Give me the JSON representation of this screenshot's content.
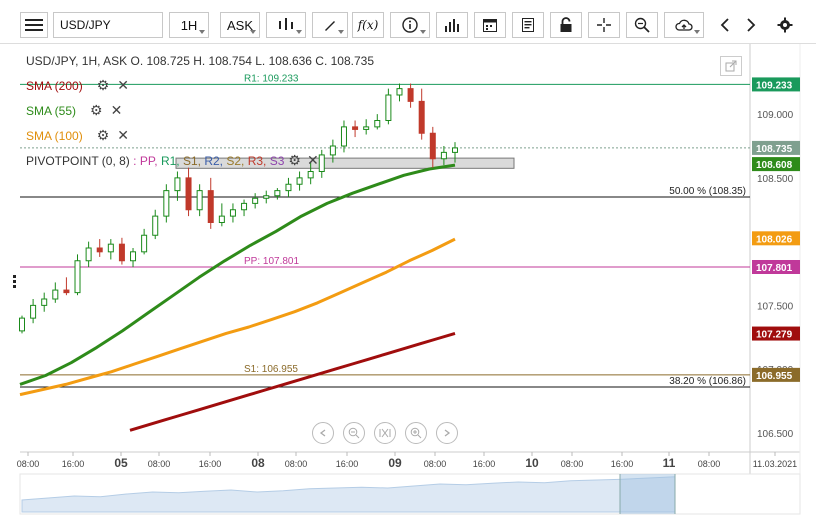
{
  "toolbar": {
    "symbol": "USD/JPY",
    "timeframe": "1H",
    "price_type": "ASK",
    "fx_label": "f(x)"
  },
  "chart_info": {
    "ohlc": "USD/JPY, 1H, ASK   O. 108.725 H. 108.754 L. 108.636 C. 108.735"
  },
  "indicators": [
    {
      "label": "SMA (200)",
      "color": "#a00d0d"
    },
    {
      "label": "SMA (55)",
      "color": "#2e8b1a"
    },
    {
      "label": "SMA (100)",
      "color": "#f39c12"
    }
  ],
  "pivot": {
    "label": "PIVOTPOINT (0, 8)",
    "sep": " : ",
    "items": [
      {
        "text": "PP,",
        "color": "#c0399a"
      },
      {
        "text": " R1,",
        "color": "#1a9a5c"
      },
      {
        "text": " S1,",
        "color": "#8b6b2a"
      },
      {
        "text": " R2,",
        "color": "#3a5da8"
      },
      {
        "text": " S2,",
        "color": "#9a7a2a"
      },
      {
        "text": " R3,",
        "color": "#c0392b"
      },
      {
        "text": " S3",
        "color": "#8e44ad"
      }
    ]
  },
  "chart_data": {
    "type": "candlestick",
    "symbol": "USD/JPY",
    "y_ticks": [
      "109.000",
      "108.500",
      "107.500",
      "107.000",
      "106.500"
    ],
    "ylim": [
      106.35,
      109.55
    ],
    "x_ticks": [
      "08:00",
      "16:00",
      "05",
      "08:00",
      "16:00",
      "08",
      "08:00",
      "16:00",
      "09",
      "08:00",
      "16:00",
      "10",
      "08:00",
      "16:00",
      "11",
      "08:00",
      "11.03.2021"
    ],
    "candles": [
      [
        107.3,
        107.42,
        107.28,
        107.4
      ],
      [
        107.4,
        107.55,
        107.36,
        107.5
      ],
      [
        107.5,
        107.6,
        107.45,
        107.55
      ],
      [
        107.55,
        107.68,
        107.52,
        107.62
      ],
      [
        107.62,
        107.72,
        107.58,
        107.6
      ],
      [
        107.6,
        107.9,
        107.58,
        107.85
      ],
      [
        107.85,
        108.0,
        107.8,
        107.95
      ],
      [
        107.95,
        108.02,
        107.88,
        107.92
      ],
      [
        107.92,
        108.02,
        107.86,
        107.98
      ],
      [
        107.98,
        108.03,
        107.82,
        107.85
      ],
      [
        107.85,
        107.95,
        107.8,
        107.92
      ],
      [
        107.92,
        108.1,
        107.9,
        108.05
      ],
      [
        108.05,
        108.25,
        108.02,
        108.2
      ],
      [
        108.2,
        108.45,
        108.15,
        108.4
      ],
      [
        108.4,
        108.55,
        108.32,
        108.5
      ],
      [
        108.5,
        108.58,
        108.2,
        108.25
      ],
      [
        108.25,
        108.45,
        108.2,
        108.4
      ],
      [
        108.4,
        108.5,
        108.1,
        108.15
      ],
      [
        108.15,
        108.3,
        108.12,
        108.2
      ],
      [
        108.2,
        108.3,
        108.15,
        108.25
      ],
      [
        108.25,
        108.33,
        108.2,
        108.3
      ],
      [
        108.3,
        108.38,
        108.26,
        108.34
      ],
      [
        108.34,
        108.4,
        108.3,
        108.36
      ],
      [
        108.36,
        108.42,
        108.33,
        108.4
      ],
      [
        108.4,
        108.5,
        108.35,
        108.45
      ],
      [
        108.45,
        108.55,
        108.4,
        108.5
      ],
      [
        108.5,
        108.62,
        108.45,
        108.55
      ],
      [
        108.55,
        108.72,
        108.5,
        108.68
      ],
      [
        108.68,
        108.8,
        108.62,
        108.75
      ],
      [
        108.75,
        108.95,
        108.7,
        108.9
      ],
      [
        108.9,
        108.95,
        108.82,
        108.88
      ],
      [
        108.88,
        108.96,
        108.84,
        108.9
      ],
      [
        108.9,
        109.0,
        108.88,
        108.95
      ],
      [
        108.95,
        109.2,
        108.92,
        109.15
      ],
      [
        109.15,
        109.24,
        109.1,
        109.2
      ],
      [
        109.2,
        109.24,
        109.05,
        109.1
      ],
      [
        109.1,
        109.2,
        108.8,
        108.85
      ],
      [
        108.85,
        108.9,
        108.58,
        108.65
      ],
      [
        108.65,
        108.75,
        108.6,
        108.7
      ],
      [
        108.7,
        108.78,
        108.62,
        108.735
      ]
    ],
    "sma_200": [
      106.52,
      106.56,
      106.6,
      106.64,
      106.68,
      106.72,
      106.76,
      106.8,
      106.84,
      106.88,
      106.92,
      106.96,
      107.0,
      107.04,
      107.08,
      107.12,
      107.16,
      107.2,
      107.24,
      107.28
    ],
    "sma_55": [
      106.88,
      106.95,
      107.05,
      107.17,
      107.3,
      107.44,
      107.58,
      107.72,
      107.85,
      107.97,
      108.08,
      108.2,
      108.3,
      108.38,
      108.45,
      108.52,
      108.57,
      108.6
    ],
    "sma_100": [
      106.8,
      106.84,
      106.88,
      106.93,
      106.98,
      107.04,
      107.1,
      107.16,
      107.22,
      107.28,
      107.33,
      107.39,
      107.45,
      107.52,
      107.6,
      107.68,
      107.76,
      107.85,
      107.93,
      108.02
    ],
    "levels": [
      {
        "name": "R1",
        "label": "R1: 109.233",
        "value": 109.233,
        "color": "#1a9a5c"
      },
      {
        "name": "PP",
        "label": "PP: 107.801",
        "value": 107.801,
        "color": "#c0399a"
      },
      {
        "name": "S1",
        "label": "S1: 106.955",
        "value": 106.955,
        "color": "#8b6b2a"
      }
    ],
    "fibs": [
      {
        "label": "50.00 % (108.35)",
        "value": 108.35
      },
      {
        "label": "38.20 % (106.86)",
        "value": 106.86
      }
    ],
    "price_tags": [
      {
        "text": "109.233",
        "value": 109.233,
        "color": "#1a9a5c"
      },
      {
        "text": "108.735",
        "value": 108.735,
        "color": "#7fa08f"
      },
      {
        "text": "108.608",
        "value": 108.608,
        "color": "#2e8b1a"
      },
      {
        "text": "108.026",
        "value": 108.026,
        "color": "#f39c12"
      },
      {
        "text": "107.801",
        "value": 107.801,
        "color": "#c0399a"
      },
      {
        "text": "107.279",
        "value": 107.279,
        "color": "#a00d0d"
      },
      {
        "text": "106.955",
        "value": 106.955,
        "color": "#8b6b2a"
      }
    ],
    "navigator": [
      0.3,
      0.35,
      0.4,
      0.38,
      0.45,
      0.5,
      0.48,
      0.52,
      0.55,
      0.5,
      0.53,
      0.58,
      0.6,
      0.62,
      0.6,
      0.65,
      0.7,
      0.68,
      0.72,
      0.75,
      0.73,
      0.78,
      0.8,
      0.82,
      0.85,
      0.88
    ]
  }
}
